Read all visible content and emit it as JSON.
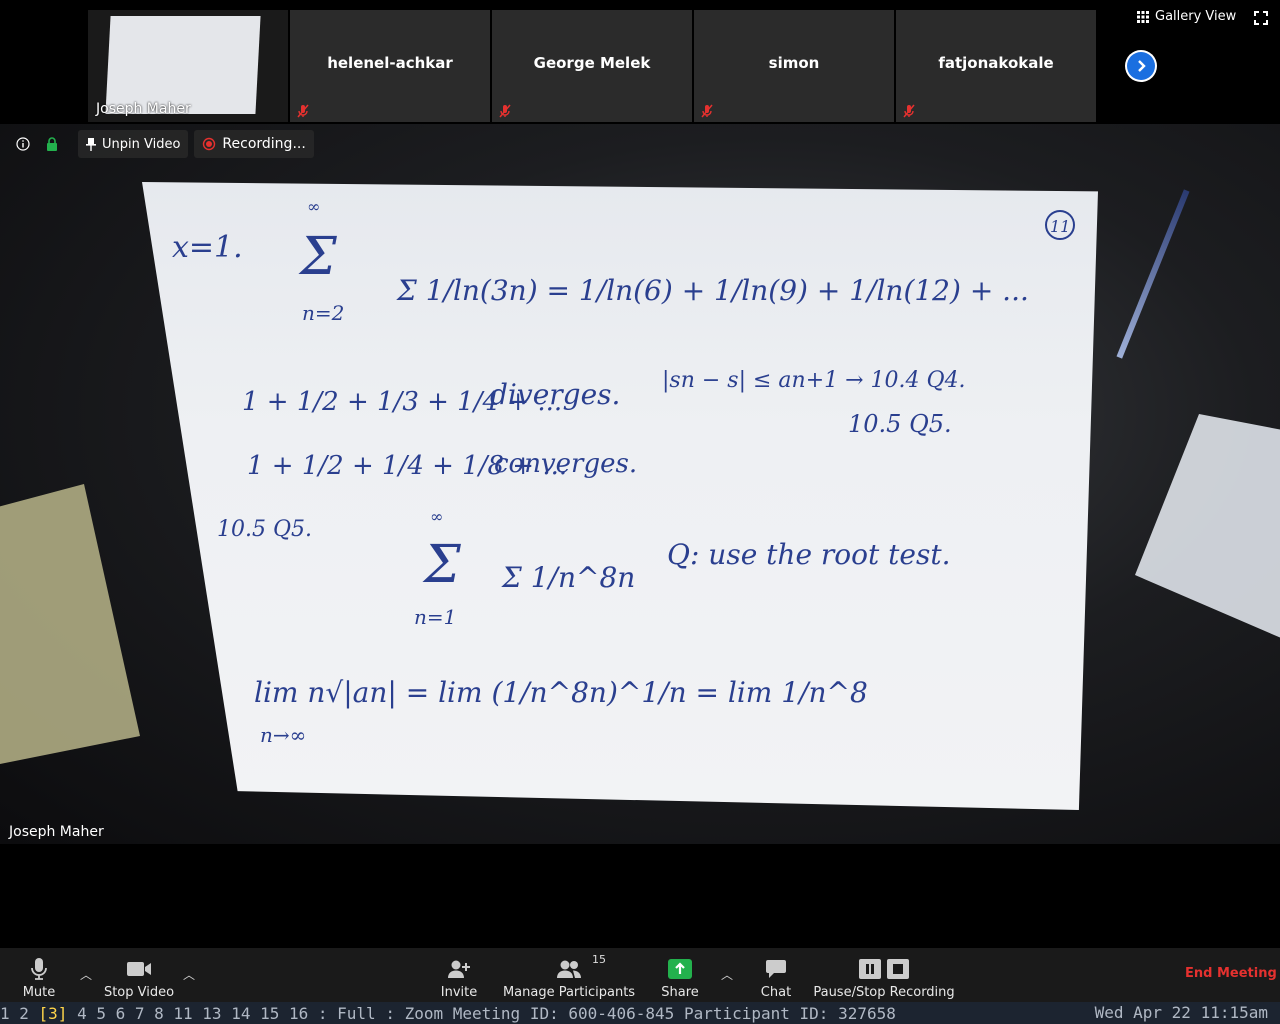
{
  "gallery": {
    "self_name": "Joseph Maher",
    "participants": [
      "helenel-achkar",
      "George Melek",
      "simon",
      "fatjonakokale"
    ],
    "view_label": "Gallery View"
  },
  "info_row": {
    "unpin_label": "Unpin Video",
    "recording_label": "Recording..."
  },
  "main": {
    "speaker_name": "Joseph Maher"
  },
  "toolbar": {
    "mute": "Mute",
    "stop_video": "Stop Video",
    "invite": "Invite",
    "manage_participants": "Manage Participants",
    "participant_count": "15",
    "share": "Share",
    "chat": "Chat",
    "pause_stop_recording": "Pause/Stop Recording",
    "end_meeting": "End Meeting"
  },
  "statusbar": {
    "workspaces_before": "1 2 ",
    "current_workspace": "[3]",
    "workspaces_after": " 4 5 6 7 8 11 13 14 15 16 : Full : Zoom Meeting ID: 600-406-845 Participant ID: 327658",
    "clock": "Wed Apr 22 11:15am"
  },
  "whiteboard": {
    "page_number": "11",
    "line1_lhs": "x=1.",
    "line1_sum": "Σ 1/ln(3n) = 1/ln(6) + 1/ln(9) + 1/ln(12) + ...",
    "sum1_bounds": [
      "∞",
      "n=2"
    ],
    "line2": "1 + 1/2 + 1/3 + 1/4 + ...",
    "line2_note": "diverges.",
    "line3": "1 + 1/2 + 1/4 + 1/8 + ...",
    "line3_note": "converges.",
    "bound_note": "|sn − s| ≤ an+1 → 10.4 Q4.",
    "bound_note2": "10.5 Q5.",
    "q_label": "10.5 Q5.",
    "sum2": "Σ 1/n^8n",
    "sum2_bounds": [
      "∞",
      "n=1"
    ],
    "q_text": "Q: use the root test.",
    "limit": "lim n√|an| = lim (1/n^8n)^1/n = lim 1/n^8",
    "limit_sub": "n→∞"
  },
  "colors": {
    "ink": "#2a3f8f",
    "toolbar": "#1a1a1a",
    "end_meeting": "#e5312f",
    "share_green": "#23b14d",
    "accent_blue": "#1b6fe0"
  }
}
